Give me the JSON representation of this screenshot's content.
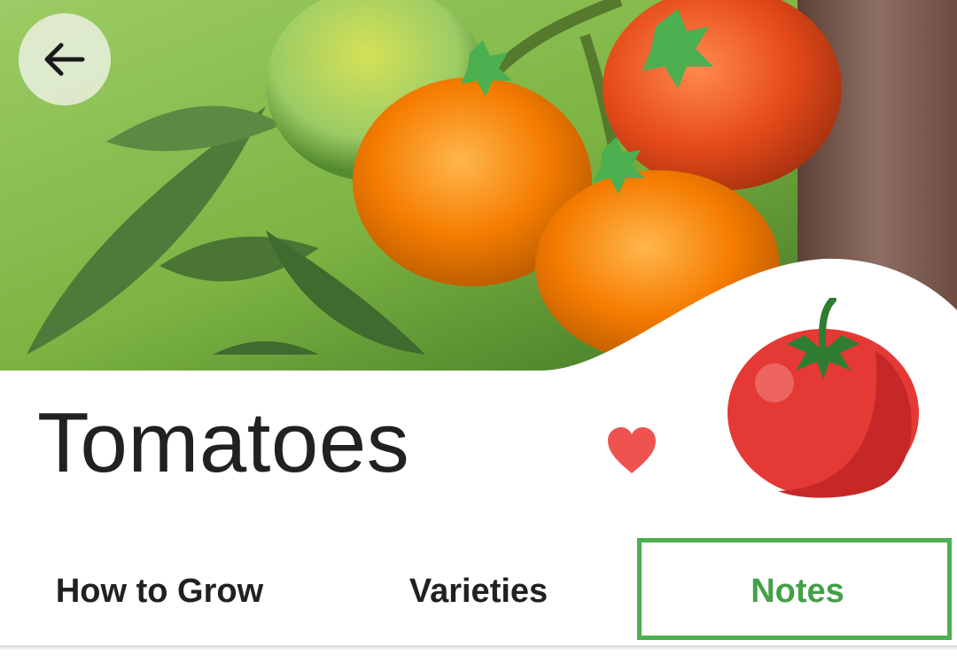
{
  "header": {
    "back_icon": "arrow-left-icon",
    "hero_image": "tomato plant photo"
  },
  "plant": {
    "title": "Tomatoes",
    "favorite_icon": "heart-icon",
    "plant_icon": "tomato-icon"
  },
  "tabs": [
    {
      "label": "How to Grow",
      "active": false
    },
    {
      "label": "Varieties",
      "active": false
    },
    {
      "label": "Notes",
      "active": true
    }
  ],
  "colors": {
    "accent": "#43a047",
    "favorite": "#ef5350",
    "title_text": "#212121"
  }
}
